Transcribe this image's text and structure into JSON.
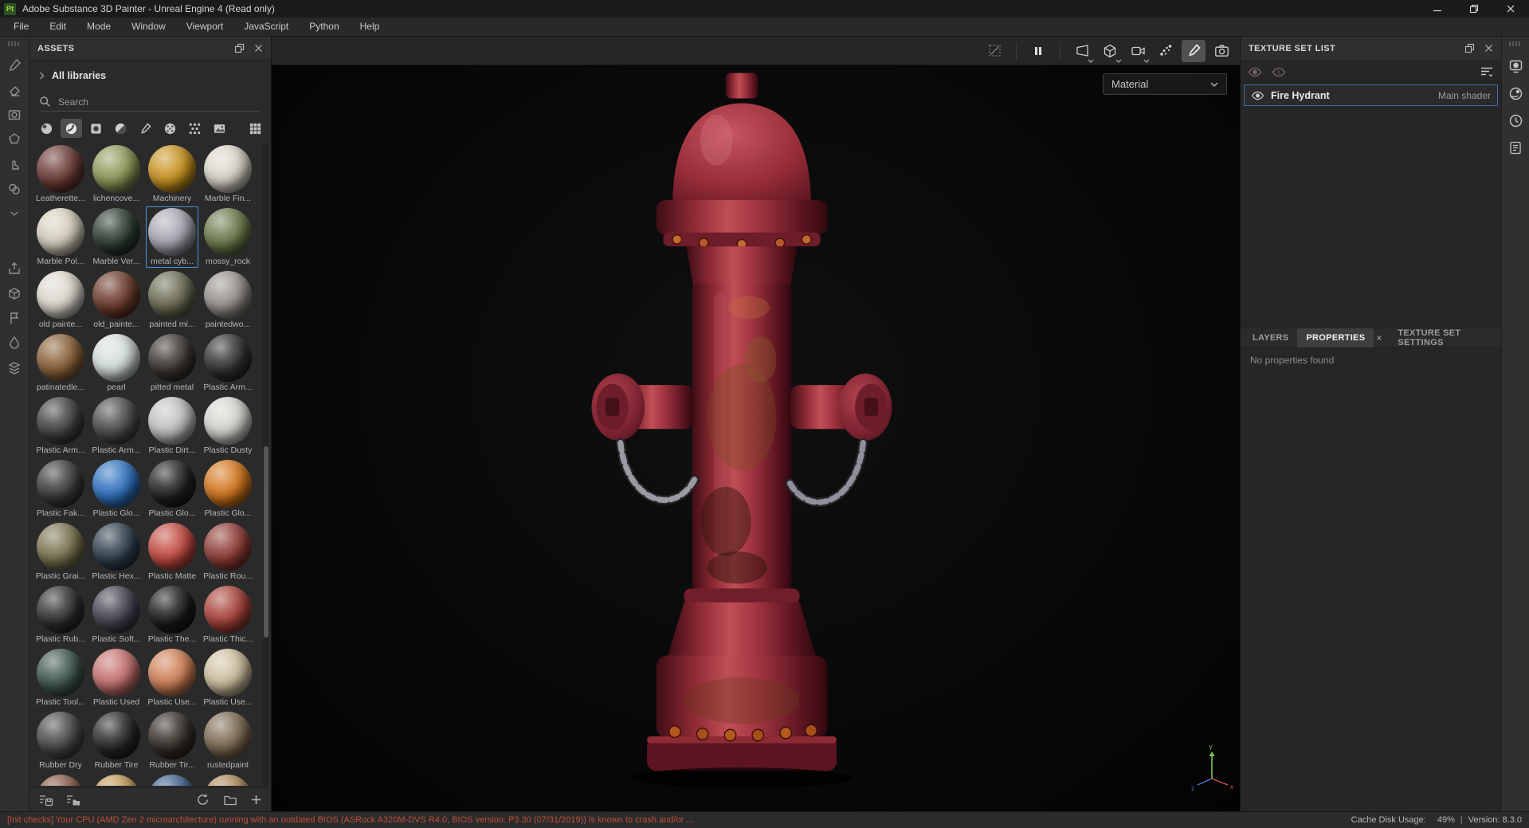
{
  "window": {
    "app_badge": "Pt",
    "title": "Adobe Substance 3D Painter - Unreal Engine 4 (Read only)",
    "controls": [
      "minimize",
      "restore",
      "close"
    ]
  },
  "menu": {
    "items": [
      "File",
      "Edit",
      "Mode",
      "Window",
      "Viewport",
      "JavaScript",
      "Python",
      "Help"
    ]
  },
  "left_toolbar": {
    "tools": [
      "paint-tool",
      "eraser-tool",
      "projection-tool",
      "polygon-fill-tool",
      "smudge-tool",
      "clone-tool",
      "expand-chevron",
      "export-tool",
      "package-tool",
      "flag-tool",
      "droplet-tool",
      "stack-tool"
    ]
  },
  "assets": {
    "title": "ASSETS",
    "library_label": "All libraries",
    "search_placeholder": "Search",
    "filters": [
      "materials",
      "smart-materials",
      "smart-masks",
      "filters",
      "brushes",
      "alphas",
      "procedurals",
      "images",
      "grid-view"
    ],
    "selected_filter": "smart-materials",
    "selected_material": "metal cyb...",
    "materials": [
      {
        "name": "Leatherette...",
        "color": "#6b3a34"
      },
      {
        "name": "lichencove...",
        "color": "#8f9a5a"
      },
      {
        "name": "Machinery",
        "color": "#c8931f"
      },
      {
        "name": "Marble Fin...",
        "color": "#d9d5c9"
      },
      {
        "name": "Marble Pol...",
        "color": "#d6d0bd"
      },
      {
        "name": "Marble Ver...",
        "color": "#2c3b31"
      },
      {
        "name": "metal cyb...",
        "color": "#a8a8b4",
        "selected": true
      },
      {
        "name": "mossy_rock",
        "color": "#6a7a4a"
      },
      {
        "name": "old painte...",
        "color": "#dcd8ce"
      },
      {
        "name": "old_painte...",
        "color": "#6b3a2a"
      },
      {
        "name": "painted mi...",
        "color": "#6a6a52"
      },
      {
        "name": "paintedwo...",
        "color": "#96928c"
      },
      {
        "name": "patinatedle...",
        "color": "#8a6138"
      },
      {
        "name": "pearl",
        "color": "#d4ded8"
      },
      {
        "name": "pitted metal",
        "color": "#3a3430"
      },
      {
        "name": "Plastic Arm...",
        "color": "#303032"
      },
      {
        "name": "Plastic Arm...",
        "color": "#3f3f41"
      },
      {
        "name": "Plastic Arm...",
        "color": "#4a4a4c"
      },
      {
        "name": "Plastic Dirt...",
        "color": "#c2c2c0"
      },
      {
        "name": "Plastic Dusty",
        "color": "#d6d4cf"
      },
      {
        "name": "Plastic Fak...",
        "color": "#3a3a3c"
      },
      {
        "name": "Plastic Glo...",
        "color": "#2e72c0"
      },
      {
        "name": "Plastic Glo...",
        "color": "#202022"
      },
      {
        "name": "Plastic Glo...",
        "color": "#d4771c"
      },
      {
        "name": "Plastic Grai...",
        "color": "#7a7450"
      },
      {
        "name": "Plastic Hex...",
        "color": "#2e3e4c"
      },
      {
        "name": "Plastic Matte",
        "color": "#c44a42"
      },
      {
        "name": "Plastic Rou...",
        "color": "#8f3b34"
      },
      {
        "name": "Plastic Rub...",
        "color": "#2e2e30"
      },
      {
        "name": "Plastic Soft...",
        "color": "#42424f"
      },
      {
        "name": "Plastic The...",
        "color": "#1a1a1c"
      },
      {
        "name": "Plastic Thic...",
        "color": "#a8423a"
      },
      {
        "name": "Plastic Tool...",
        "color": "#3d554c"
      },
      {
        "name": "Plastic Used",
        "color": "#c4706e"
      },
      {
        "name": "Plastic Use...",
        "color": "#cf8057"
      },
      {
        "name": "Plastic Use...",
        "color": "#cfc0a0"
      },
      {
        "name": "Rubber Dry",
        "color": "#474747"
      },
      {
        "name": "Rubber Tire",
        "color": "#262626"
      },
      {
        "name": "Rubber Tir...",
        "color": "#332c26"
      },
      {
        "name": "rustedpaint",
        "color": "#7d6b52"
      },
      {
        "name": "",
        "color": "#8a5a46"
      },
      {
        "name": "",
        "color": "#c09a58"
      },
      {
        "name": "",
        "color": "#3e5f8e"
      },
      {
        "name": "",
        "color": "#b08a5a"
      }
    ],
    "footer_icons": [
      "save-preset-list",
      "import-resources-list",
      "refresh",
      "new-folder",
      "add-resource"
    ]
  },
  "viewport": {
    "toolbar_icons": [
      "deselect",
      "pause-engine",
      "perspective-view",
      "mesh-view",
      "camera-view",
      "particles",
      "paint-brush",
      "screenshot"
    ],
    "active_toolbar_icon": "paint-brush",
    "shading_mode": "Material",
    "axis": {
      "y": "Y",
      "x": "x",
      "z": "z"
    }
  },
  "texture_set_list": {
    "title": "TEXTURE SET LIST",
    "items": [
      {
        "name": "Fire Hydrant",
        "shader": "Main shader",
        "selected": true,
        "visible": true
      }
    ]
  },
  "properties": {
    "tabs": [
      "LAYERS",
      "PROPERTIES",
      "TEXTURE SET SETTINGS"
    ],
    "active_tab": "PROPERTIES",
    "empty_message": "No properties found"
  },
  "right_dock": {
    "icons": [
      "display-settings",
      "shader-settings",
      "history",
      "log"
    ]
  },
  "status": {
    "warning": "[Init checks] Your CPU (AMD Zen 2 microarchitecture) running with an outdated BIOS (ASRock A320M-DVS R4.0, BIOS version: P3.30 (07/31/2019)) is known to crash and/or ...",
    "cache_label": "Cache Disk Usage:",
    "cache_value": "49%",
    "version_label": "Version:",
    "version_value": "8.3.0"
  },
  "colors": {
    "selection_blue": "#4a90d9",
    "warning_red": "#c05038",
    "hydrant_red": "#8e2a34",
    "app_icon_green": "#a6d94e"
  }
}
